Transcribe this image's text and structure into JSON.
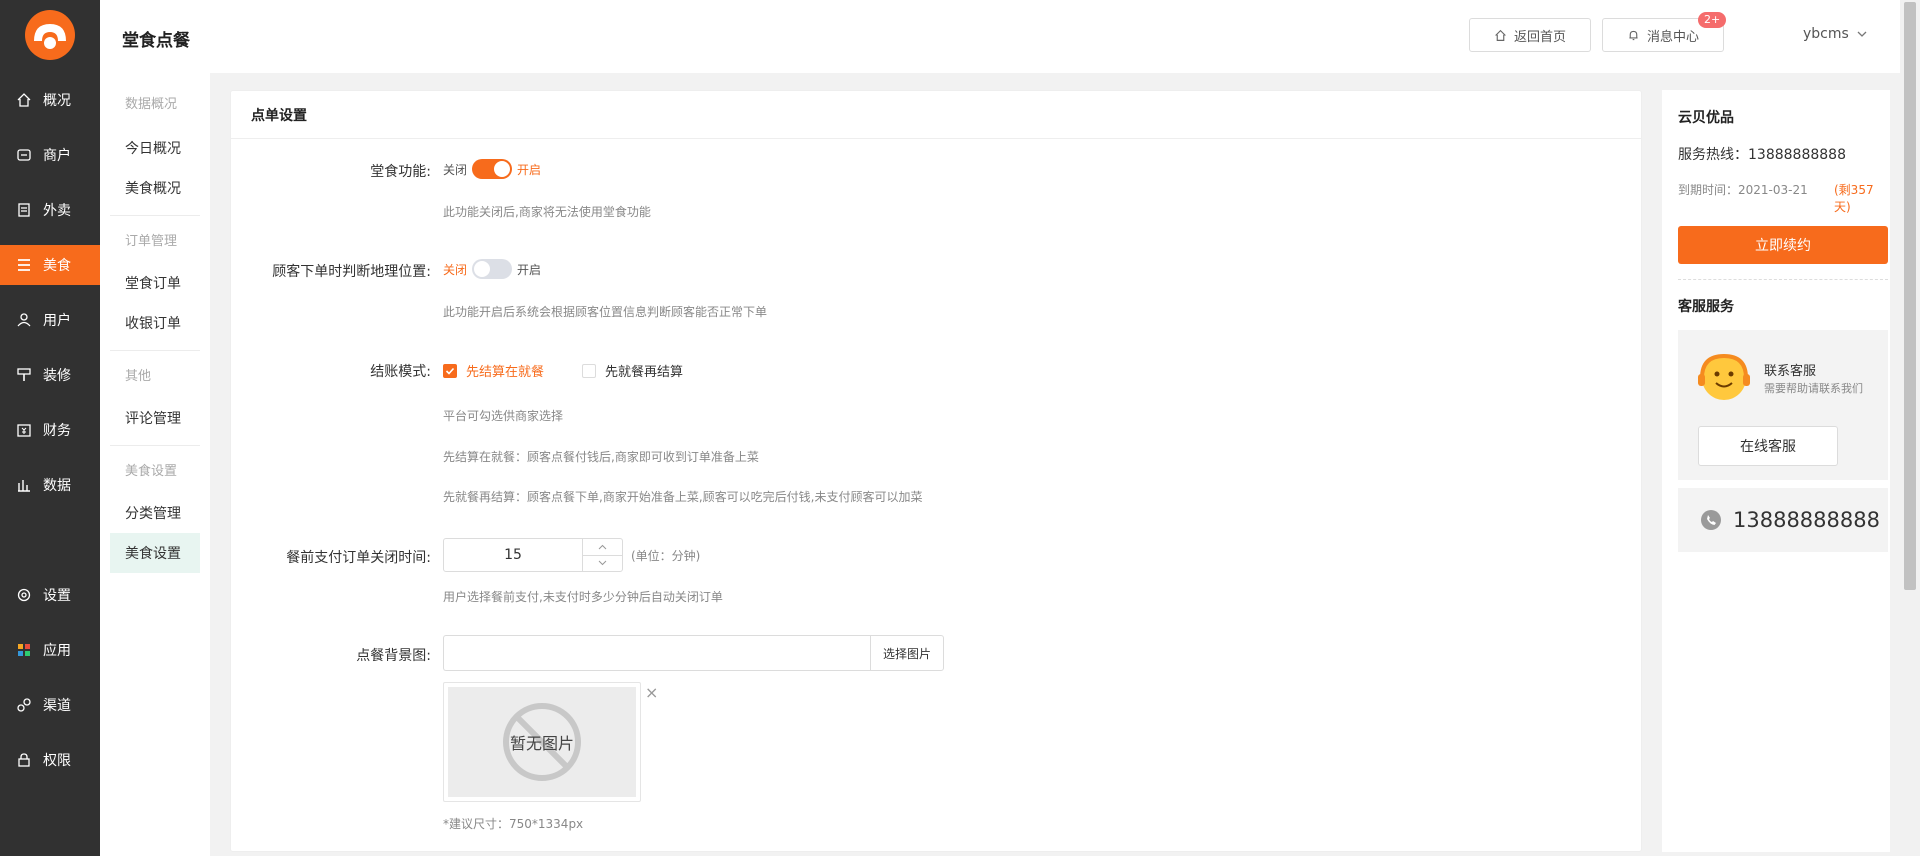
{
  "app": {
    "title": "堂食点餐"
  },
  "header": {
    "home_label": "返回首页",
    "msg_label": "消息中心",
    "msg_badge": "2+",
    "user": "ybcms"
  },
  "nav": {
    "items": [
      {
        "label": "概况",
        "icon": "home-icon"
      },
      {
        "label": "商户",
        "icon": "store-icon"
      },
      {
        "label": "外卖",
        "icon": "list-icon"
      },
      {
        "label": "美食",
        "icon": "menu-icon"
      },
      {
        "label": "用户",
        "icon": "user-icon"
      },
      {
        "label": "装修",
        "icon": "decorate-icon"
      },
      {
        "label": "财务",
        "icon": "finance-icon"
      },
      {
        "label": "数据",
        "icon": "chart-icon"
      },
      {
        "label": "设置",
        "icon": "gear-icon"
      },
      {
        "label": "应用",
        "icon": "apps-icon"
      },
      {
        "label": "渠道",
        "icon": "link-icon"
      },
      {
        "label": "权限",
        "icon": "lock-icon"
      }
    ],
    "active": "美食"
  },
  "subnav": {
    "groups": [
      {
        "title": "数据概况",
        "items": [
          "今日概况",
          "美食概况"
        ]
      },
      {
        "title": "订单管理",
        "items": [
          "堂食订单",
          "收银订单"
        ]
      },
      {
        "title": "其他",
        "items": [
          "评论管理"
        ]
      },
      {
        "title": "美食设置",
        "items": [
          "分类管理",
          "美食设置"
        ]
      }
    ],
    "active": "美食设置"
  },
  "card": {
    "title": "点单设置"
  },
  "form": {
    "dine_in": {
      "label": "堂食功能:",
      "off": "关闭",
      "on": "开启",
      "value": true,
      "hint": "此功能关闭后,商家将无法使用堂食功能"
    },
    "location": {
      "label": "顾客下单时判断地理位置:",
      "off": "关闭",
      "on": "开启",
      "value": false,
      "hint": "此功能开启后系统会根据顾客位置信息判断顾客能否正常下单"
    },
    "checkout": {
      "label": "结账模式:",
      "options": [
        {
          "label": "先结算在就餐",
          "checked": true
        },
        {
          "label": "先就餐再结算",
          "checked": false
        }
      ],
      "hints": [
        "平台可勾选供商家选择",
        "先结算在就餐：顾客点餐付钱后,商家即可收到订单准备上菜",
        "先就餐再结算：顾客点餐下单,商家开始准备上菜,顾客可以吃完后付钱,未支付顾客可以加菜"
      ]
    },
    "close_time": {
      "label": "餐前支付订单关闭时间:",
      "value": "15",
      "unit": "(单位：分钟)",
      "hint": "用户选择餐前支付,未支付时多少分钟后自动关闭订单"
    },
    "bg_image": {
      "label": "点餐背景图:",
      "value": "",
      "button": "选择图片",
      "empty": "暂无图片",
      "close": "×",
      "hint": "*建议尺寸：750*1334px"
    }
  },
  "right": {
    "brand": "云贝优品",
    "hotline": "服务热线：13888888888",
    "expire_label": "到期时间：2021-03-21",
    "remaining": "(剩357天)",
    "renew": "立即续约",
    "service_title": "客服服务",
    "contact_title": "联系客服",
    "contact_sub": "需要帮助请联系我们",
    "online_btn": "在线客服",
    "phone": "13888888888"
  },
  "colors": {
    "accent": "#f76b1c",
    "nav_bg": "#313131",
    "active_sub": "#e8f5f1"
  }
}
